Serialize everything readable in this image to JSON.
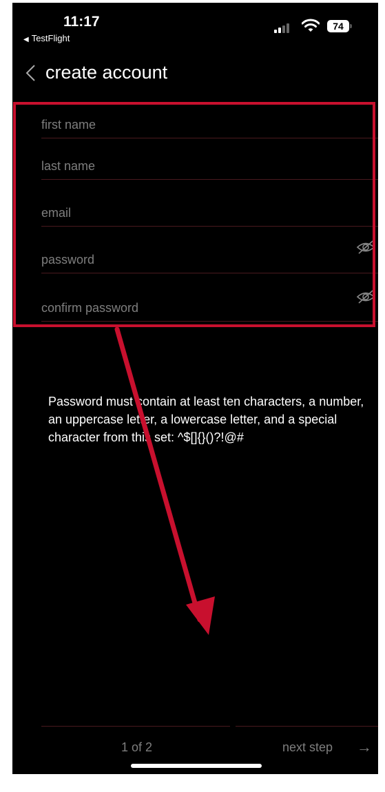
{
  "status_bar": {
    "time": "11:17",
    "back_app": "TestFlight",
    "battery": "74"
  },
  "header": {
    "title": "create account"
  },
  "form": {
    "first_name": {
      "placeholder": "first name",
      "value": ""
    },
    "last_name": {
      "placeholder": "last name",
      "value": ""
    },
    "email": {
      "placeholder": "email",
      "value": ""
    },
    "password": {
      "placeholder": "password",
      "value": ""
    },
    "confirm_password": {
      "placeholder": "confirm password",
      "value": ""
    }
  },
  "help_text": "Password must contain at least ten characters, a number, an uppercase letter, a lowercase letter, and a special character from this set: ^$[]{}()?!@#",
  "footer": {
    "step_count": "1 of 2",
    "next_label": "next step",
    "next_arrow": "→"
  },
  "icons": {
    "back": "chevron-left-icon",
    "eye": "eye-slash-icon"
  },
  "colors": {
    "background": "#000000",
    "annotation": "#c8102e",
    "divider": "#4a1a1f",
    "placeholder": "#7e7e7e"
  }
}
